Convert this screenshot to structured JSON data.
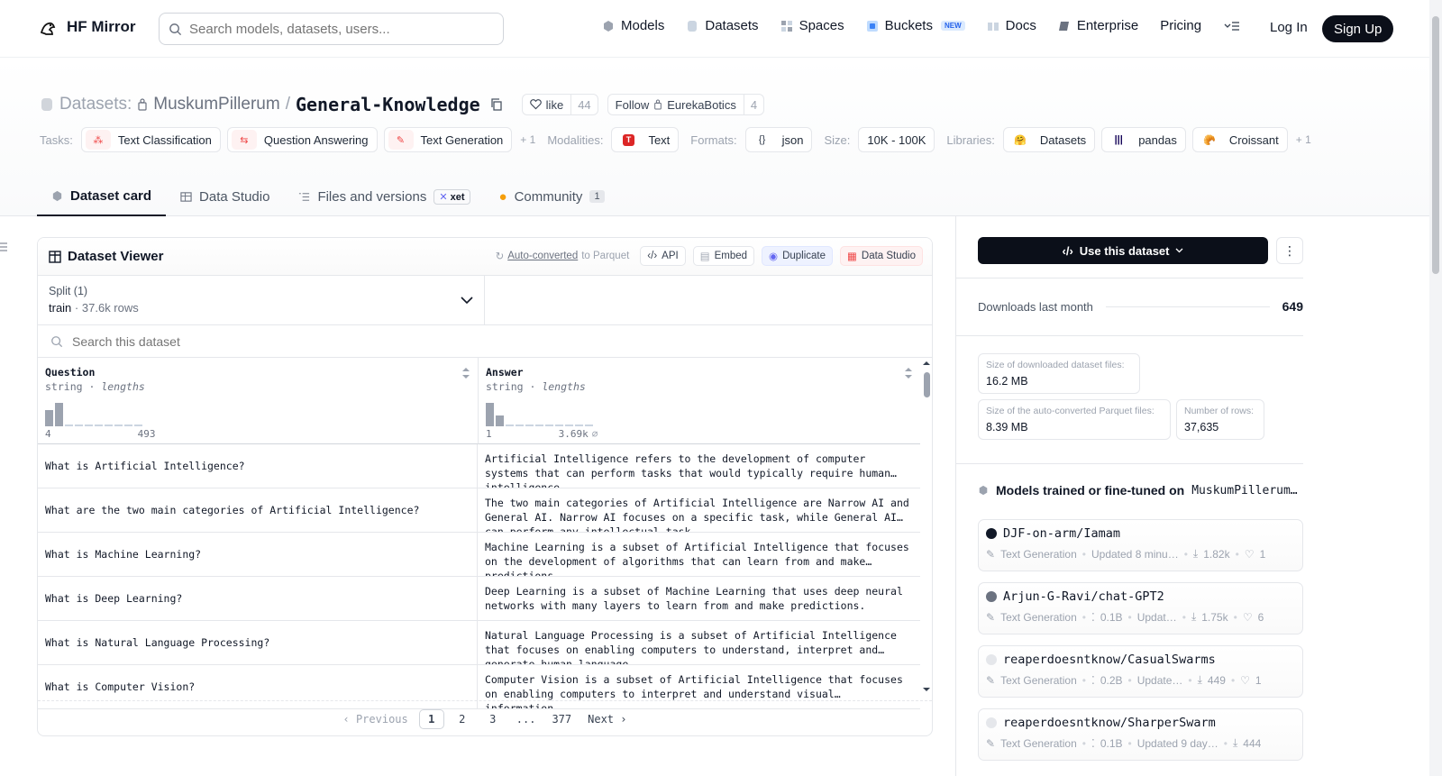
{
  "brand": {
    "name": "HF Mirror"
  },
  "search": {
    "placeholder": "Search models, datasets, users..."
  },
  "nav": {
    "models": "Models",
    "datasets": "Datasets",
    "spaces": "Spaces",
    "buckets": "Buckets",
    "buckets_badge": "NEW",
    "docs": "Docs",
    "enterprise": "Enterprise",
    "pricing": "Pricing",
    "login": "Log In",
    "signup": "Sign Up"
  },
  "dataset": {
    "prefix": "Datasets:",
    "owner": "MuskumPillerum",
    "separator": "/",
    "name": "General-Knowledge",
    "like_label": "like",
    "like_count": "44",
    "follow_label": "Follow",
    "follow_org": "EurekaBotics",
    "follow_count": "4"
  },
  "tags": {
    "tasks_label": "Tasks:",
    "task1": "Text Classification",
    "task2": "Question Answering",
    "task3": "Text Generation",
    "tasks_more": "+ 1",
    "modalities_label": "Modalities:",
    "modality1": "Text",
    "formats_label": "Formats:",
    "format1": "json",
    "size_label": "Size:",
    "size1": "10K - 100K",
    "libraries_label": "Libraries:",
    "lib1": "Datasets",
    "lib2": "pandas",
    "lib3": "Croissant",
    "libs_more": "+ 1"
  },
  "tabs": {
    "card": "Dataset card",
    "studio": "Data Studio",
    "files": "Files and versions",
    "xet": "xet",
    "community": "Community",
    "community_count": "1"
  },
  "viewer": {
    "title": "Dataset Viewer",
    "autoconv_link": "Auto-converted",
    "autoconv_rest": "to Parquet",
    "api": "API",
    "embed": "Embed",
    "duplicate": "Duplicate",
    "data_studio": "Data Studio",
    "split_label": "Split (1)",
    "split_name": "train",
    "split_rows": "37.6k rows",
    "search_placeholder": "Search this dataset",
    "columns": [
      {
        "name": "Question",
        "type": "string",
        "stat": "lengths",
        "min": "4",
        "max": "493",
        "hist": [
          0.7,
          1.0,
          0.05,
          0.05,
          0.05,
          0.05,
          0.05,
          0.05,
          0.05,
          0.05
        ]
      },
      {
        "name": "Answer",
        "type": "string",
        "stat": "lengths",
        "min": "1",
        "max": "3.69k",
        "max_suffix": "⌀",
        "hist": [
          1.0,
          0.45,
          0.08,
          0.05,
          0.05,
          0.05,
          0.05,
          0.05,
          0.05,
          0.05,
          0.05
        ]
      }
    ],
    "rows": [
      {
        "q": "What is Artificial Intelligence?",
        "a": "Artificial Intelligence refers to the development of computer systems that can perform tasks that would typically require human intelligence."
      },
      {
        "q": "What are the two main categories of Artificial Intelligence?",
        "a": "The two main categories of Artificial Intelligence are Narrow AI and General AI. Narrow AI focuses on a specific task, while General AI can perform any intellectual task."
      },
      {
        "q": "What is Machine Learning?",
        "a": "Machine Learning is a subset of Artificial Intelligence that focuses on the development of algorithms that can learn from and make predictions."
      },
      {
        "q": "What is Deep Learning?",
        "a": "Deep Learning is a subset of Machine Learning that uses deep neural networks with many layers to learn from and make predictions."
      },
      {
        "q": "What is Natural Language Processing?",
        "a": "Natural Language Processing is a subset of Artificial Intelligence that focuses on enabling computers to understand, interpret and generate human language."
      },
      {
        "q": "What is Computer Vision?",
        "a": "Computer Vision is a subset of Artificial Intelligence that focuses on enabling computers to interpret and understand visual information."
      }
    ],
    "pager": {
      "prev": "Previous",
      "p1": "1",
      "p2": "2",
      "p3": "3",
      "ellipsis": "...",
      "last": "377",
      "next": "Next"
    }
  },
  "sidebar": {
    "use_button": "Use this dataset",
    "downloads_label": "Downloads last month",
    "downloads_value": "649",
    "dl_size_label": "Size of downloaded dataset files:",
    "dl_size_value": "16.2 MB",
    "parquet_label": "Size of the auto-converted Parquet files:",
    "parquet_value": "8.39 MB",
    "rows_label": "Number of rows:",
    "rows_value": "37,635",
    "models_title": "Models trained or fine-tuned on",
    "models_owner": "MuskumPillerum…",
    "models": [
      {
        "name": "DJF-on-arm/Iamam",
        "task": "Text Generation",
        "params": "",
        "updated": "Updated 8 minu…",
        "downloads": "1.82k",
        "likes": "1",
        "avatar": "#111827"
      },
      {
        "name": "Arjun-G-Ravi/chat-GPT2",
        "task": "Text Generation",
        "params": "0.1B",
        "updated": "Updat…",
        "downloads": "1.75k",
        "likes": "6",
        "avatar": "#6b7280"
      },
      {
        "name": "reaperdoesntknow/CasualSwarms",
        "task": "Text Generation",
        "params": "0.2B",
        "updated": "Update…",
        "downloads": "449",
        "likes": "1",
        "avatar": "#e5e7eb"
      },
      {
        "name": "reaperdoesntknow/SharperSwarm",
        "task": "Text Generation",
        "params": "0.1B",
        "updated": "Updated 9 day…",
        "downloads": "444",
        "likes": "",
        "avatar": "#e5e7eb"
      }
    ]
  }
}
